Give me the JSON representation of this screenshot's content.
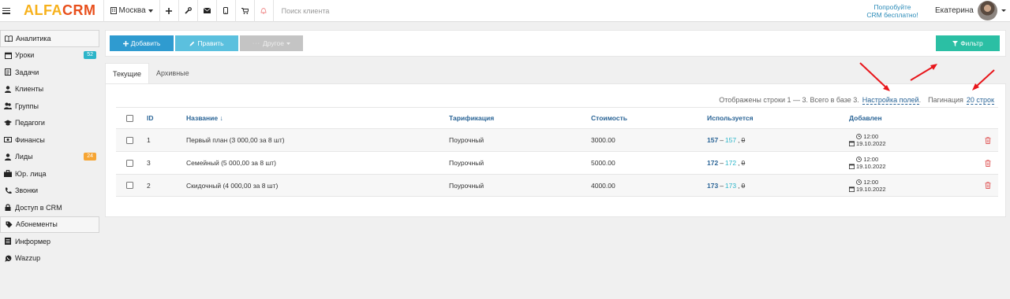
{
  "header": {
    "logo_left": "ALFA",
    "logo_right": "CRM",
    "city": "Москва",
    "search_placeholder": "Поиск клиента",
    "try_line1": "Попробуйте",
    "try_line2": "CRM бесплатно!",
    "user_name": "Екатерина"
  },
  "sidebar": {
    "items": [
      {
        "label": "Аналитика",
        "icon": "book-icon"
      },
      {
        "label": "Уроки",
        "icon": "calendar-icon",
        "badge": "52",
        "badge_color": "#2cb5c9"
      },
      {
        "label": "Задачи",
        "icon": "tasks-icon"
      },
      {
        "label": "Клиенты",
        "icon": "user-icon"
      },
      {
        "label": "Группы",
        "icon": "users-icon"
      },
      {
        "label": "Педагоги",
        "icon": "graduation-cap-icon"
      },
      {
        "label": "Финансы",
        "icon": "money-icon"
      },
      {
        "label": "Лиды",
        "icon": "user-icon",
        "badge": "24",
        "badge_color": "#f6a534"
      },
      {
        "label": "Юр. лица",
        "icon": "briefcase-icon"
      },
      {
        "label": "Звонки",
        "icon": "phone-icon"
      },
      {
        "label": "Доступ в CRM",
        "icon": "lock-icon"
      },
      {
        "label": "Абонементы",
        "icon": "tag-icon"
      },
      {
        "label": "Информер",
        "icon": "list-icon"
      },
      {
        "label": "Wazzup",
        "icon": "whatsapp-icon"
      }
    ]
  },
  "toolbar": {
    "add_label": "Добавить",
    "edit_label": "Править",
    "other_label": "Другое",
    "filter_label": "Фильтр"
  },
  "tabs": {
    "current": "Текущие",
    "archive": "Архивные"
  },
  "info": {
    "shown": "Отображены строки 1 — 3. Всего в базе 3.",
    "settings": "Настройка полей",
    "dot": ".",
    "pagination_label": "Пагинация",
    "pagination_value": "20 строк"
  },
  "table": {
    "columns": [
      "ID",
      "Название ↓",
      "Тарификация",
      "Стоимость",
      "Используется",
      "Добавлен"
    ],
    "rows": [
      {
        "id": "1",
        "name": "Первый план (3 000,00 за 8 шт)",
        "tariff": "Поурочный",
        "cost": "3000.00",
        "used_a": "157",
        "used_b": "157",
        "used_c": "0",
        "time": "12:00",
        "date": "19.10.2022"
      },
      {
        "id": "3",
        "name": "Семейный (5 000,00 за 8 шт)",
        "tariff": "Поурочный",
        "cost": "5000.00",
        "used_a": "172",
        "used_b": "172",
        "used_c": "0",
        "time": "12:00",
        "date": "19.10.2022"
      },
      {
        "id": "2",
        "name": "Скидочный (4 000,00 за 8 шт)",
        "tariff": "Поурочный",
        "cost": "4000.00",
        "used_a": "173",
        "used_b": "173",
        "used_c": "0",
        "time": "12:00",
        "date": "19.10.2022"
      }
    ]
  },
  "colors": {
    "primary": "#2f9bd0",
    "light_blue": "#5bc0de",
    "gray_button": "#c4c4c4",
    "filter": "#2bbfa4",
    "annotation_arrow": "#e8161b",
    "delete": "#e05a5a"
  }
}
